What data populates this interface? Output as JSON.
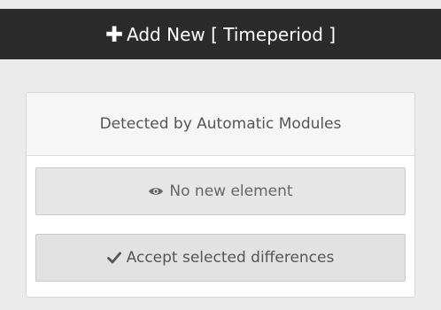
{
  "header": {
    "add_new_label": "Add New [ Timeperiod ]"
  },
  "panel": {
    "title": "Detected by Automatic Modules",
    "no_new_label": "No new element",
    "accept_label": "Accept selected differences"
  },
  "icons": {
    "add": "plus-icon",
    "view": "eye-icon",
    "accept": "check-icon"
  }
}
